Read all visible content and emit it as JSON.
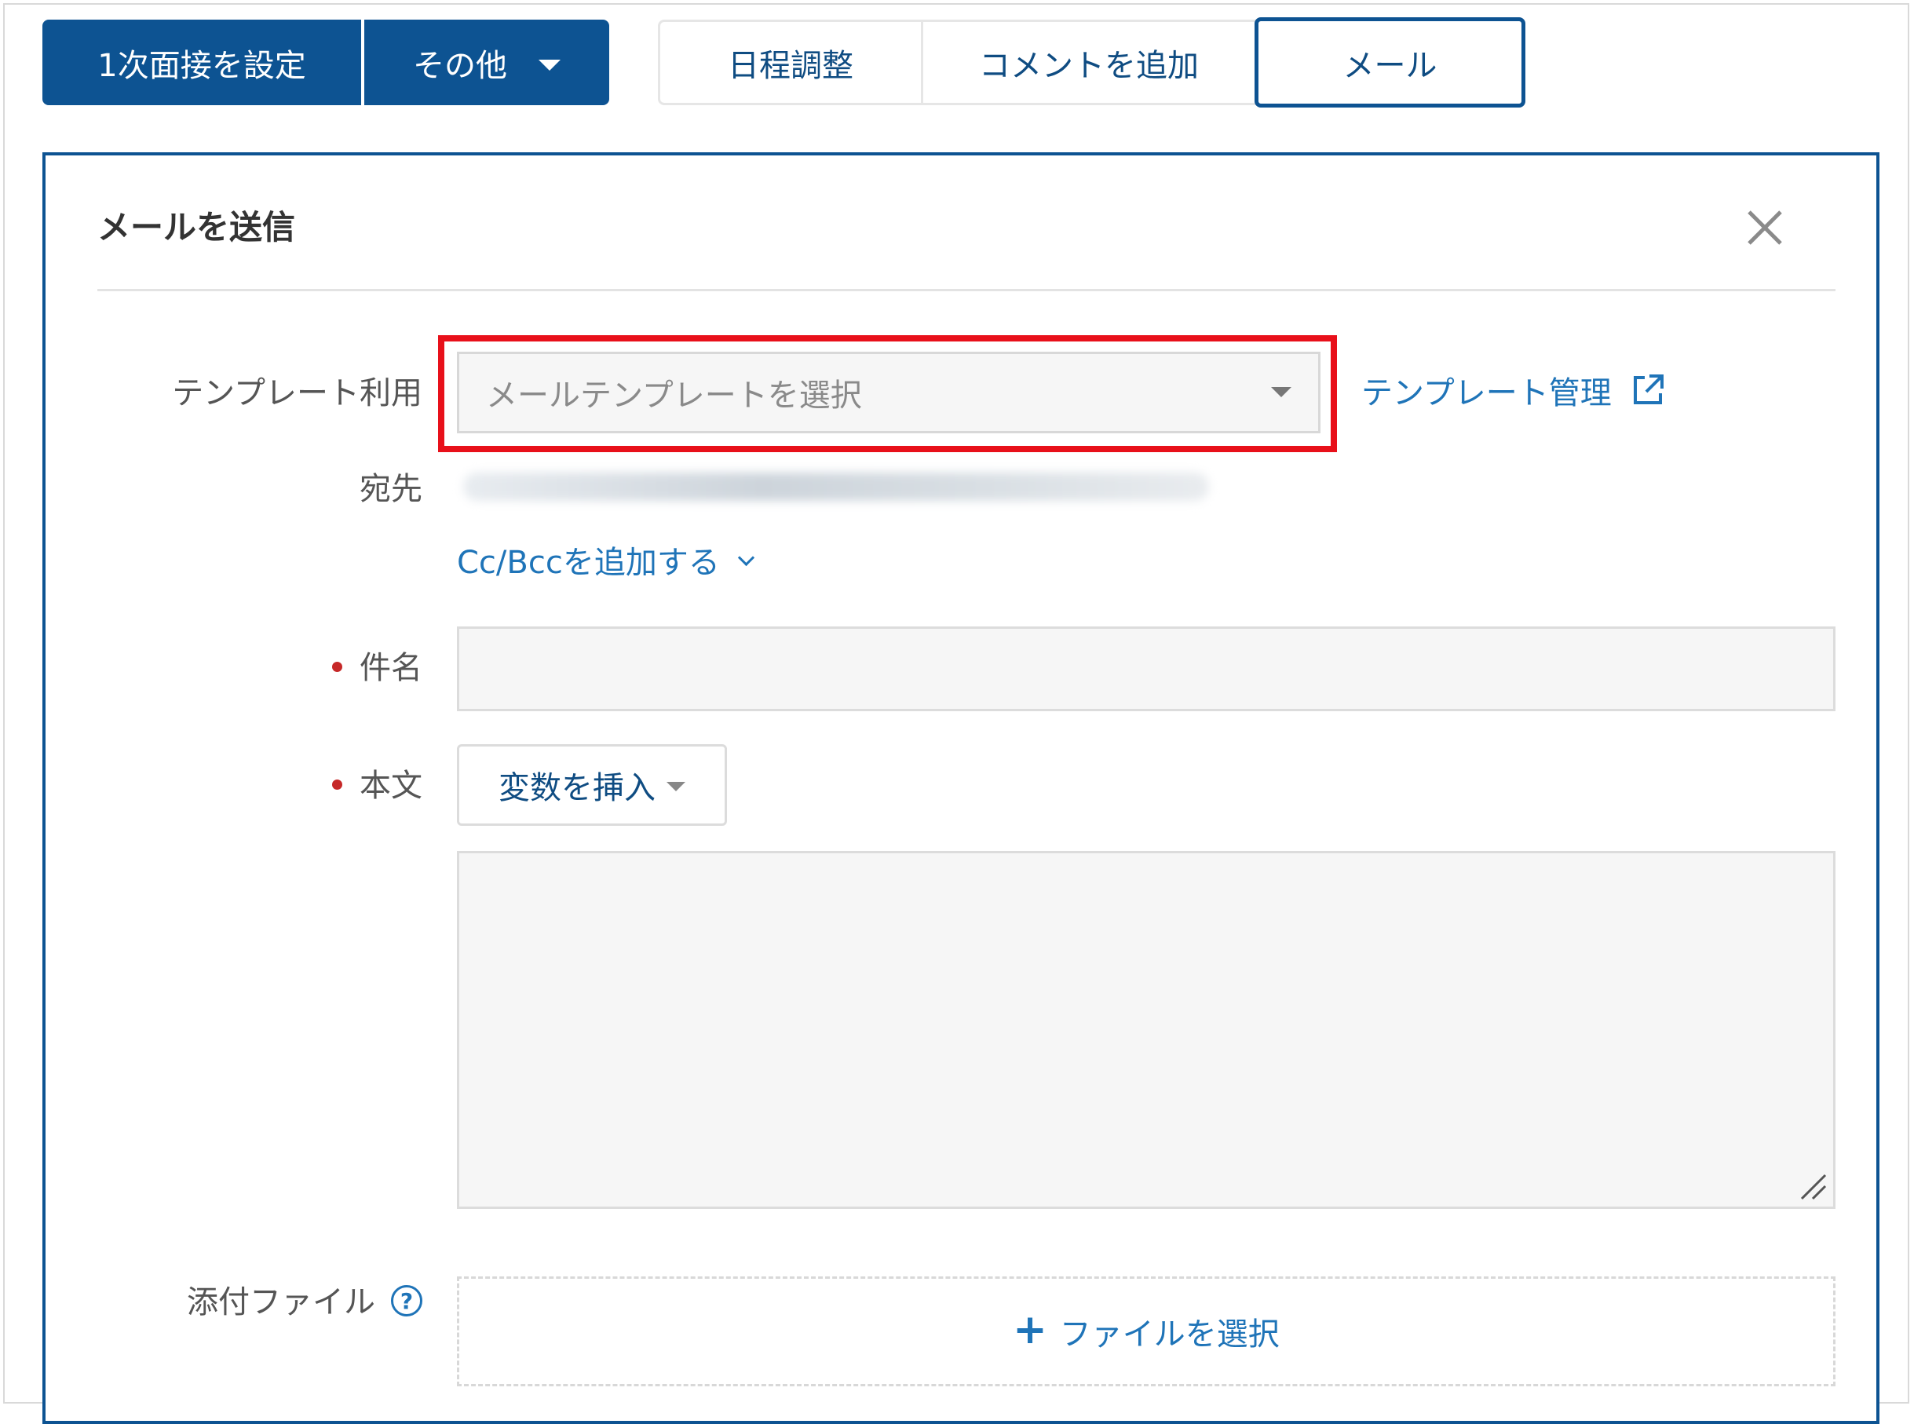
{
  "toolbar": {
    "primary_button": "1次面接を設定",
    "other_button": "その他",
    "tabs": [
      {
        "label": "日程調整"
      },
      {
        "label": "コメントを追加"
      },
      {
        "label": "メール"
      }
    ]
  },
  "panel": {
    "title": "メールを送信",
    "fields": {
      "template_label": "テンプレート利用",
      "template_placeholder": "メールテンプレートを選択",
      "template_manage_link": "テンプレート管理",
      "recipient_label": "宛先",
      "ccbcc_link": "Cc/Bccを追加する",
      "subject_label": "件名",
      "body_label": "本文",
      "insert_variable_button": "変数を挿入",
      "attachment_label": "添付ファイル",
      "select_file_button": "ファイルを選択"
    }
  },
  "colors": {
    "primary": "#0d5392",
    "link": "#1f74b8",
    "highlight": "#e8101a",
    "required": "#c62828"
  },
  "icons": [
    "caret-down-icon",
    "close-icon",
    "external-link-icon",
    "chevron-down-icon",
    "plus-icon",
    "help-icon",
    "resize-grip-icon"
  ]
}
